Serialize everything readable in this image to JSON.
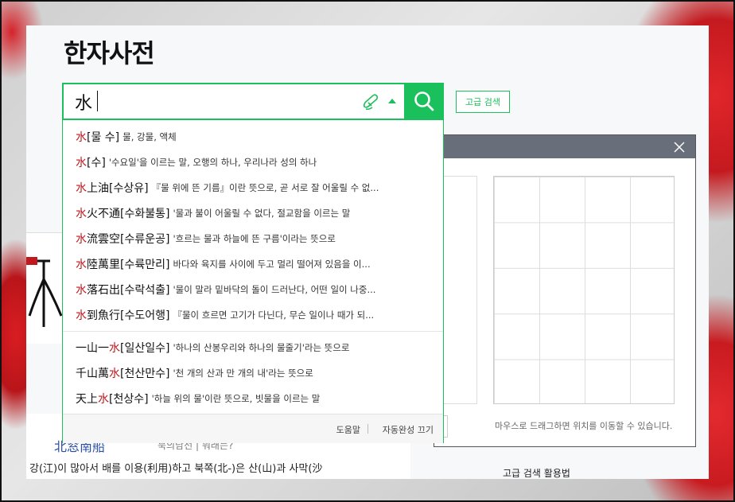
{
  "page": {
    "title": "한자사전"
  },
  "search": {
    "value": "水",
    "advanced_label": "고급 검색"
  },
  "icons": {
    "handwrite": "handwrite-pen-icon",
    "dropdown": "triangle-up-icon",
    "search": "magnifier-icon",
    "close": "close-icon"
  },
  "colors": {
    "accent": "#19c05b",
    "highlight": "#c0181e",
    "modal_header": "#686e7a"
  },
  "autocomplete": {
    "items": [
      {
        "pre": "",
        "hl": "水",
        "post": "",
        "reading": "[물 수]",
        "def": "물, 강물, 액체"
      },
      {
        "pre": "",
        "hl": "水",
        "post": "",
        "reading": "[수]",
        "def": "'수요일'을 이르는 말, 오행의 하나, 우리나라 성의 하나"
      },
      {
        "pre": "",
        "hl": "水",
        "post": "上油",
        "reading": "[수상유]",
        "def": "『물 위에 뜬 기름』이란 뜻으로, 곧 서로 잘 어울릴 수 없..."
      },
      {
        "pre": "",
        "hl": "水",
        "post": "火不通",
        "reading": "[수화불통]",
        "def": "'물과 불이 어울릴 수 없다, 절교함을 이르는 말"
      },
      {
        "pre": "",
        "hl": "水",
        "post": "流雲空",
        "reading": "[수류운공]",
        "def": "'흐르는 물과 하늘에 뜬 구름'이라는 뜻으로"
      },
      {
        "pre": "",
        "hl": "水",
        "post": "陸萬里",
        "reading": "[수륙만리]",
        "def": "바다와 육지를 사이에 두고 멀리 떨어져 있음을 이..."
      },
      {
        "pre": "",
        "hl": "水",
        "post": "落石出",
        "reading": "[수락석출]",
        "def": "'물이 말라 밑바닥의 돌이 드러난다, 어떤 일이 나중..."
      },
      {
        "pre": "",
        "hl": "水",
        "post": "到魚行",
        "reading": "[수도어행]",
        "def": "『물이 흐르면 고기가 다닌다, 무슨 일이나 때가 되..."
      },
      {
        "pre": "一山一",
        "hl": "水",
        "post": "",
        "reading": "[일산일수]",
        "def": "'하나의 산봉우리와 하나의 물줄기'라는 뜻으로"
      },
      {
        "pre": "千山萬",
        "hl": "水",
        "post": "",
        "reading": "[천산만수]",
        "def": "'천 개의 산과 만 개의 내'라는 뜻으로"
      },
      {
        "pre": "天上",
        "hl": "水",
        "post": "",
        "reading": "[천상수]",
        "def": "'하늘 위의 물'이란 뜻으로, 빗물을 이르는 말"
      }
    ],
    "help_label": "도움말",
    "off_label": "자동완성 끄기"
  },
  "handwriting": {
    "hint": "마우스로 드래그하면 위치를 이동할 수 있습니다."
  },
  "background": {
    "related_word": "北窓南船",
    "related_extra": "북의남선 | 뭐래는?",
    "description": "강(江)이 많아서 배를 이용(利用)하고 북쪽(北-)은 산(山)과 사막(沙",
    "guide": "고급 검색 활용법"
  }
}
